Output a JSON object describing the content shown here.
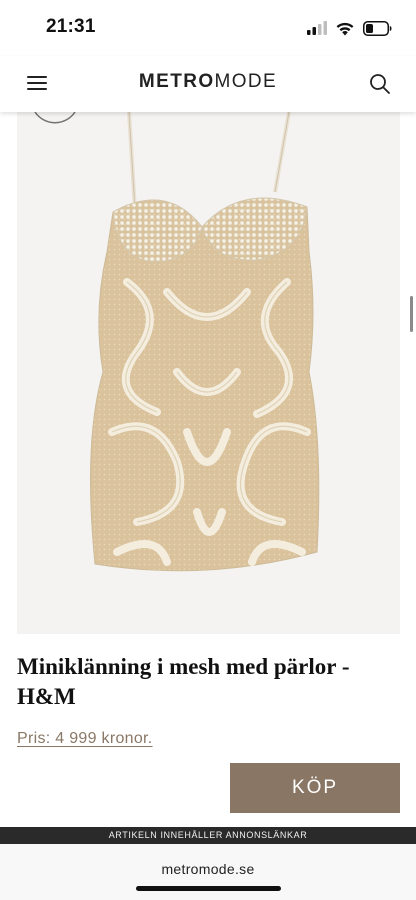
{
  "status_bar": {
    "time": "21:31"
  },
  "header": {
    "logo_bold": "METRO",
    "logo_light": "MODE",
    "menu_icon": "hamburger-menu-icon",
    "search_icon": "search-icon"
  },
  "product": {
    "title": "Miniklänning i mesh med pärlor - H&M",
    "price": "Pris: 4 999 kronor.",
    "buy_label": "KÖP"
  },
  "footer": {
    "ad_notice": "ARTIKELN INNEHÅLLER ANNONSLÄNKAR",
    "url": "metromode.se"
  },
  "colors": {
    "accent": "#8a7664",
    "price_link": "#8a7866",
    "banner": "#2a2a2a"
  }
}
